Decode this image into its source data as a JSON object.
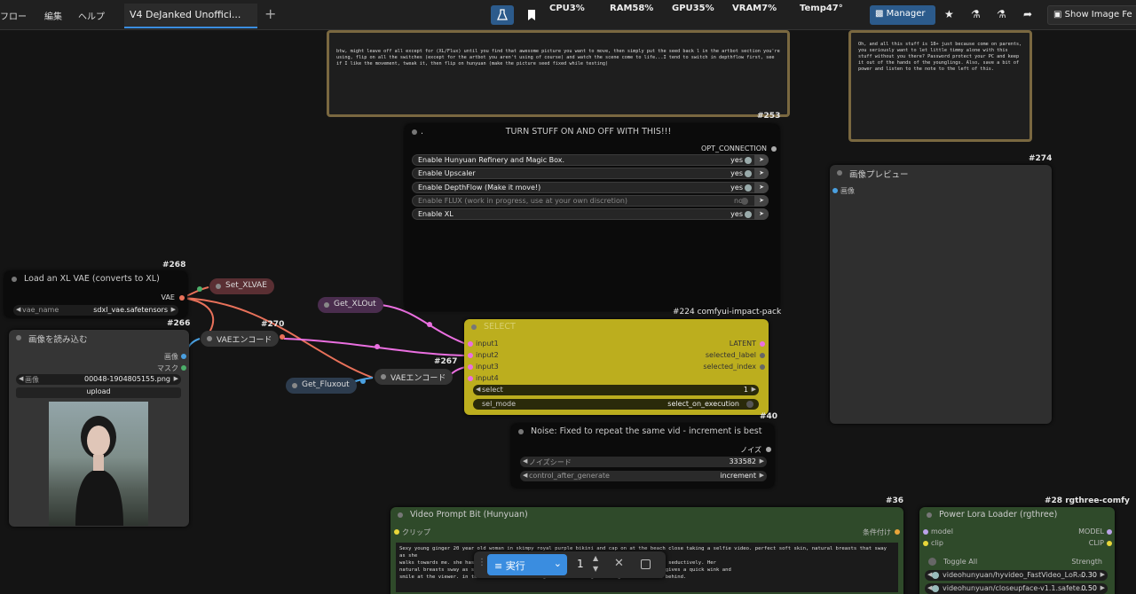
{
  "menu": {
    "items": [
      "フロー",
      "編集",
      "ヘルプ"
    ]
  },
  "tab": {
    "title": "V4 DeJanked Unoffici...",
    "new_tab": "+"
  },
  "stats": {
    "cpu": "CPU3%",
    "ram": "RAM58%",
    "gpu": "GPU35%",
    "vram": "VRAM7%",
    "temp": "Temp47°"
  },
  "toolbar": {
    "manager": "Manager",
    "show_image": "Show Image Fe"
  },
  "notes": {
    "left_text": "btw, might leave off all except for (XL/Flux) until you find that awesome picture you want to move, then simply put the seed back l in the artbot section you're using, flip on all the switches (except for the artbot you aren't using of course) and watch the scene come to life...I tend to switch in depthflow first, see if I like the movement, tweak it, then flip on hunyuan (make the picture seed fixed while testing)",
    "left_id": "#253",
    "right_text": "Oh, and all this stuff is 18+ just because come on parents, you seriously want to let little timmy alone with this stuff without you there? Password protect your PC and keep it out of the hands of the younglings. Also, save a bit of power and listen to the note to the left of this."
  },
  "switch_node": {
    "title": "TURN STUFF ON AND OFF WITH THIS!!!",
    "dot": ".",
    "output": "OPT_CONNECTION",
    "rows": [
      {
        "label": "Enable Hunyuan Refinery and Magic Box.",
        "state": "yes"
      },
      {
        "label": "Enable Upscaler",
        "state": "yes"
      },
      {
        "label": "Enable DepthFlow (Make it move!)",
        "state": "yes"
      },
      {
        "label": "Enable FLUX (work in progress, use at your own discretion)",
        "state": "no"
      },
      {
        "label": "Enable XL",
        "state": "yes"
      }
    ]
  },
  "preview_node": {
    "id": "#274",
    "title": "画像プレビュー",
    "input": "画像"
  },
  "vae_loader": {
    "id": "#268",
    "title": "Load an XL VAE (converts to XL)",
    "output": "VAE",
    "field_label": "vae_name",
    "field_value": "sdxl_vae.safetensors",
    "id2": "#266"
  },
  "set_xlvae": {
    "label": "Set_XLVAE"
  },
  "get_xlout": {
    "label": "Get_XLOut"
  },
  "get_fluxout": {
    "label": "Get_Fluxout"
  },
  "vae_encode1": {
    "label": "VAEエンコード",
    "id": "#270"
  },
  "vae_encode2": {
    "label": "VAEエンコード",
    "id": "#267"
  },
  "load_image": {
    "title": "画像を読み込む",
    "out1": "画像",
    "out2": "マスク",
    "field_label": "画像",
    "field_value": "00048-1904805155.png",
    "upload": "upload"
  },
  "select_node": {
    "id": "#224 comfyui-impact-pack",
    "title": "SELECT",
    "inputs": [
      "input1",
      "input2",
      "input3",
      "input4"
    ],
    "outputs": [
      "LATENT",
      "selected_label",
      "selected_index"
    ],
    "select_label": "select",
    "select_value": "1",
    "mode_label": "sel_mode",
    "mode_value": "select_on_execution",
    "corner": "#40"
  },
  "noise_node": {
    "title": "Noise: Fixed to repeat the same vid - increment is best",
    "output": "ノイズ",
    "seed_label": "ノイズシード",
    "seed_value": "333582",
    "cag_label": "control_after_generate",
    "cag_value": "increment"
  },
  "prompt_node": {
    "id": "#36",
    "title": "Video Prompt Bit (Hunyuan)",
    "input": "クリップ",
    "output": "条件付け",
    "text_line1": "Sexy young ginger 20 year old woman in skimpy royal purple bikini and cap on at the beach close taking a selfie video. perfect soft skin, natural breasts that sway as she",
    "text_line2": "walks towards me. she has ... illuring while winking at the viewer. then smiles and talks seductively. Her",
    "text_line3": "natural breasts sway as sh ... the viewer then straight ahead talking while walking. she gives a quick wink and",
    "text_line4": "smile at the viewer. in th ... woman in the background in a thong watching the surf from behind."
  },
  "lora_node": {
    "id": "#28 rgthree-comfy",
    "title": "Power Lora Loader (rgthree)",
    "in1": "model",
    "in2": "clip",
    "out1": "MODEL",
    "out2": "CLIP",
    "toggle_all": "Toggle All",
    "strength": "Strength",
    "loras": [
      {
        "name": "videohunyuan/hyvideo_FastVideo_LoR...",
        "value": "-0.30"
      },
      {
        "name": "videohunyuan/closeupface-v1.1.safete...",
        "value": "0.50"
      }
    ]
  },
  "run_bar": {
    "run_label": "実行",
    "count": "1"
  },
  "colors": {
    "accent": "#3a8de0",
    "select_node": "#c4b52a",
    "note_border": "#7a6840",
    "prompt_node": "#2f4a2a"
  }
}
